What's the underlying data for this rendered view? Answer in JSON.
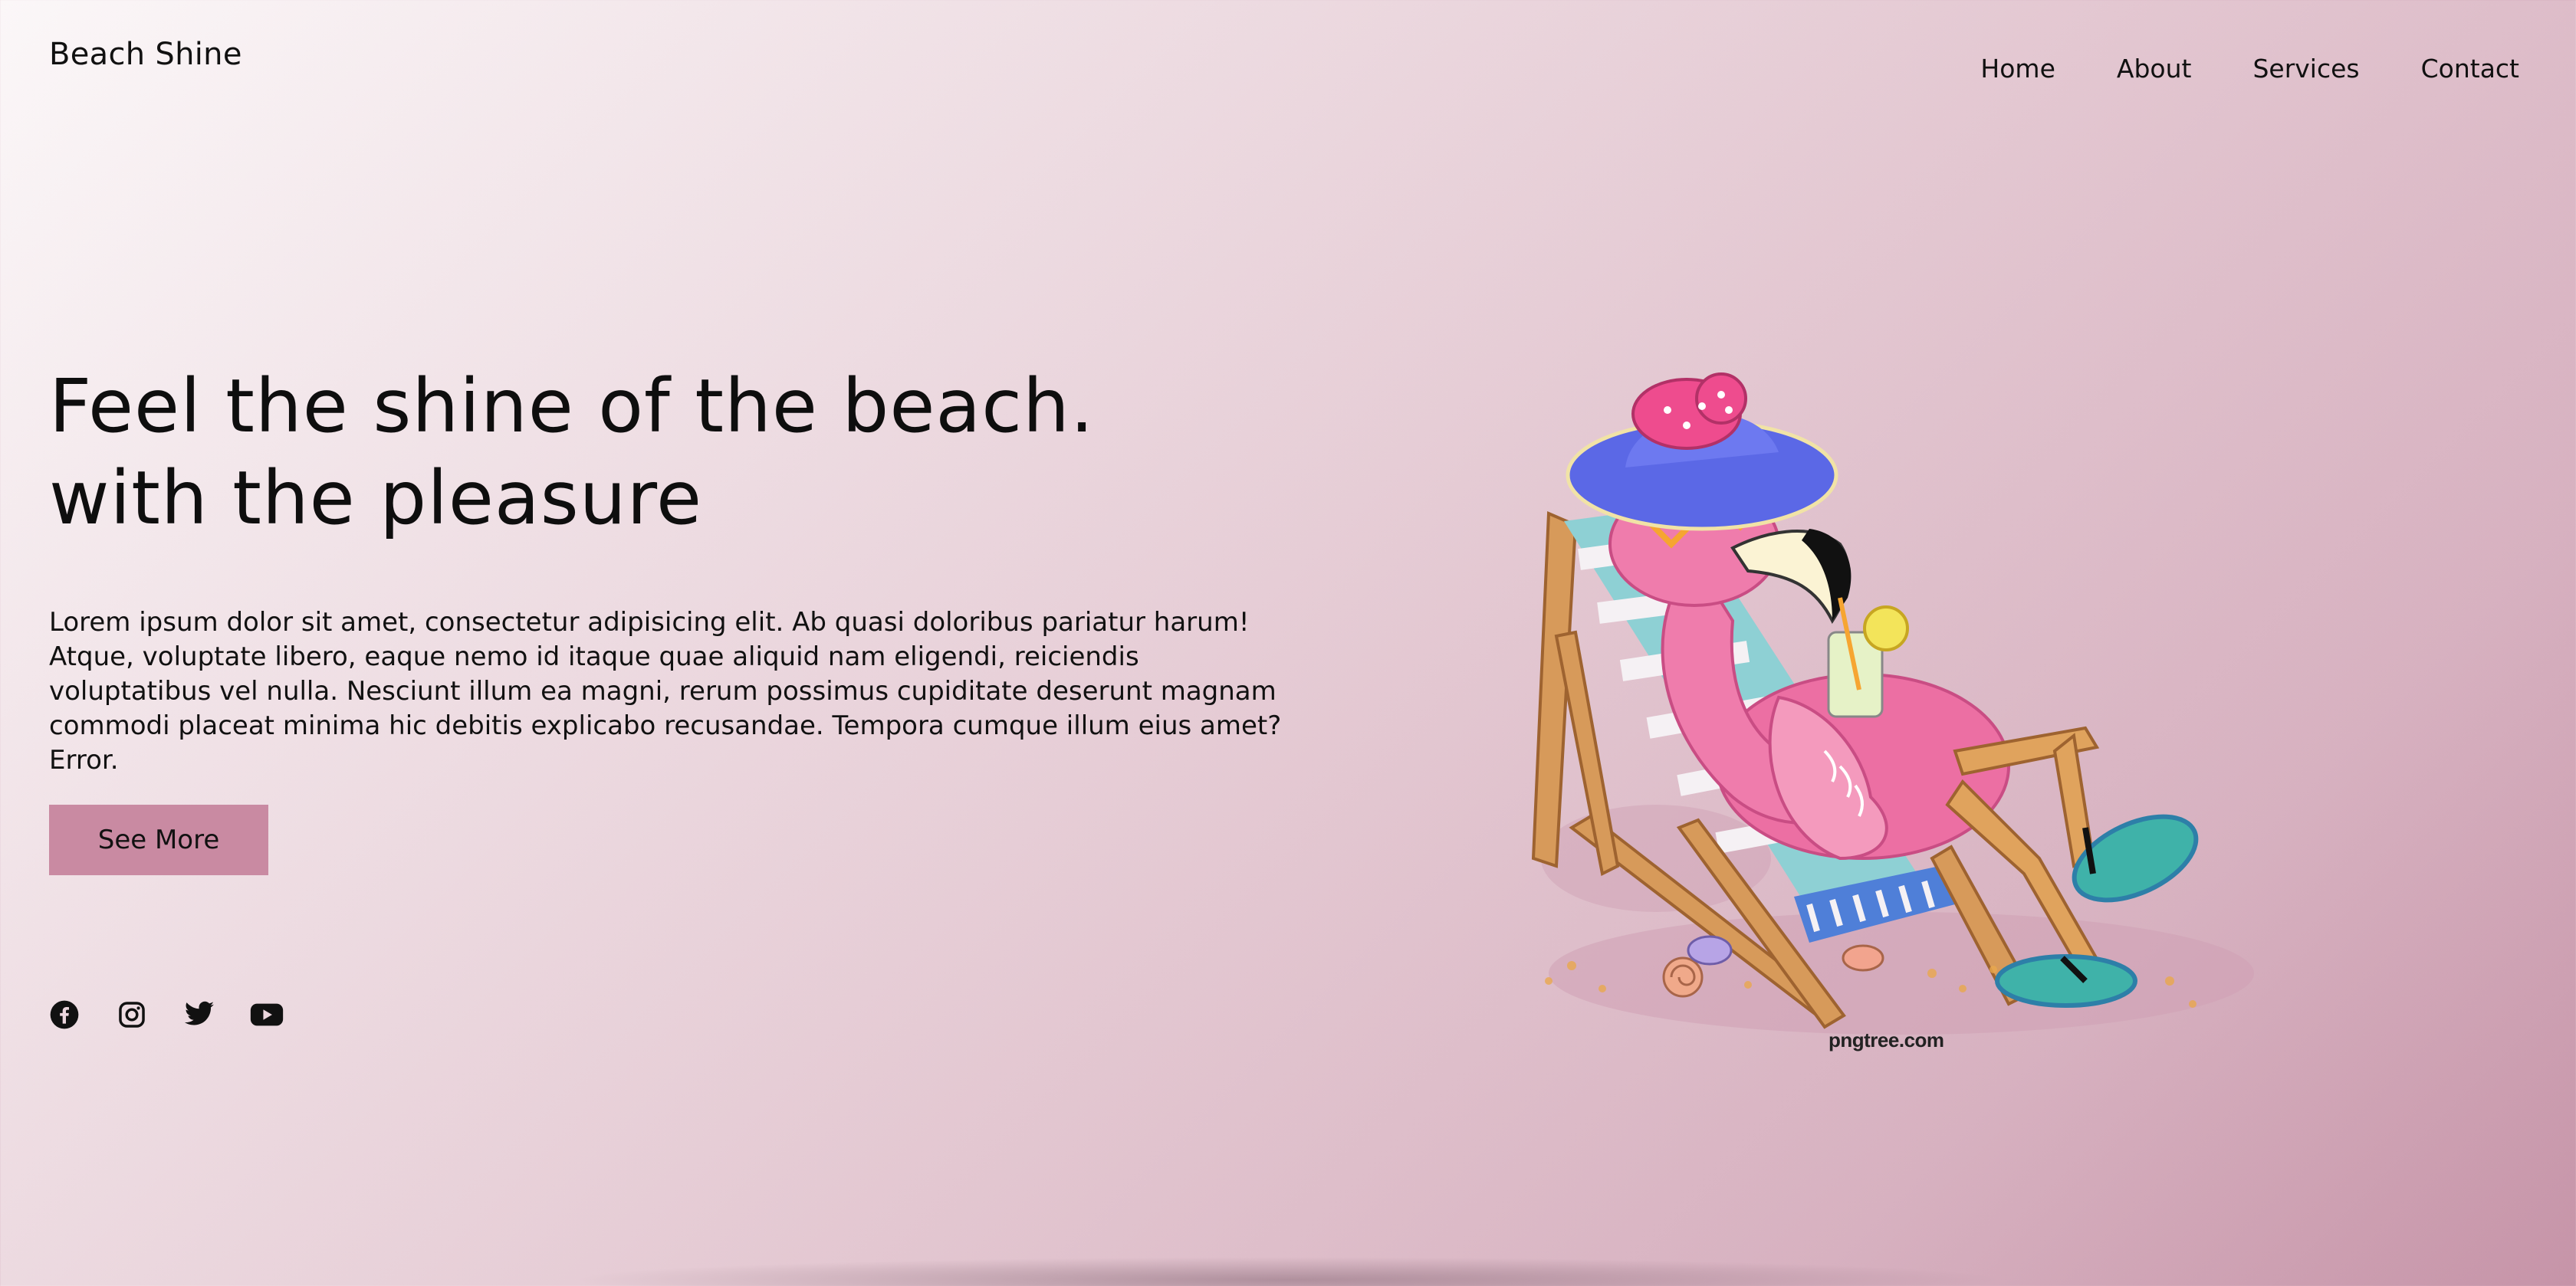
{
  "header": {
    "logo": "Beach Shine",
    "nav": [
      "Home",
      "About",
      "Services",
      "Contact"
    ]
  },
  "hero": {
    "title_line1": "Feel the shine of the beach.",
    "title_line2": "with the pleasure",
    "paragraph": "Lorem ipsum dolor sit amet, consectetur adipisicing elit. Ab quasi doloribus pariatur harum! Atque, voluptate libero, eaque nemo id itaque quae aliquid nam eligendi, reiciendis voluptatibus vel nulla. Nesciunt illum ea magni, rerum possimus cupiditate deserunt magnam commodi placeat minima hic debitis explicabo recusandae. Tempora cumque illum eius amet? Error.",
    "button_label": "See More"
  },
  "socials": [
    "facebook-icon",
    "instagram-icon",
    "twitter-icon",
    "youtube-icon"
  ],
  "illustration": {
    "watermark": "pngtree.com"
  },
  "colors": {
    "accent_button": "#c98aa2",
    "bg_light": "#fbf7f8",
    "bg_dark": "#c694a8"
  }
}
